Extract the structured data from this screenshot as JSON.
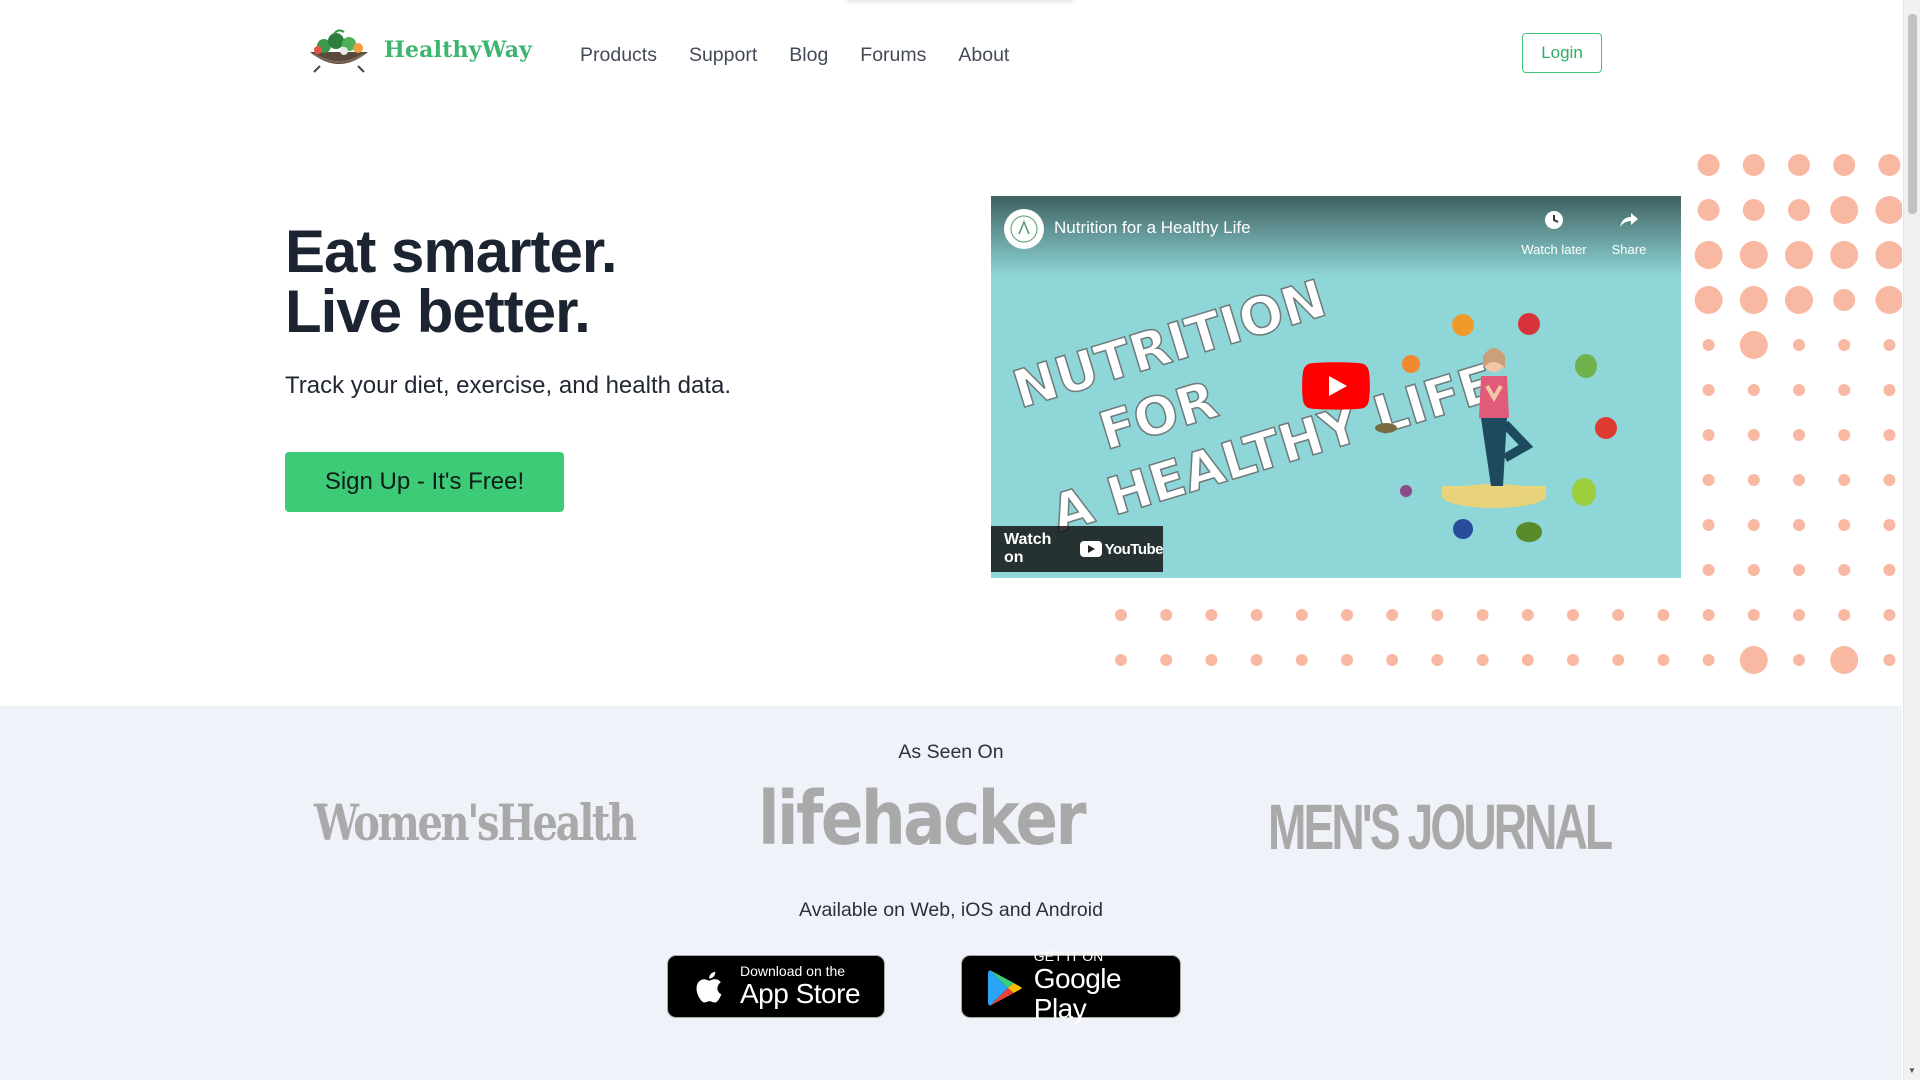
{
  "brand": {
    "logo_text": "HealthyWay",
    "accent_color": "#3ecb78"
  },
  "nav": {
    "items": [
      "Products",
      "Support",
      "Blog",
      "Forums",
      "About"
    ],
    "login_label": "Login"
  },
  "hero": {
    "title_line1": "Eat smarter.",
    "title_line2": "Live better.",
    "subtitle": "Track your diet, exercise, and health data.",
    "cta_label": "Sign Up - It's Free!"
  },
  "video": {
    "title": "Nutrition for a Healthy Life",
    "watch_later_label": "Watch later",
    "share_label": "Share",
    "thumbnail_text": [
      "NUTRITION",
      "FOR",
      "A HEALTHY LIFE"
    ],
    "watch_on_label": "Watch on",
    "youtube_label": "YouTube",
    "background_color": "#8ed6d7"
  },
  "press": {
    "heading": "As Seen On",
    "logos": [
      "Women'sHealth",
      "lifehacker",
      "MEN'S JOURNAL"
    ]
  },
  "apps": {
    "heading": "Available on Web, iOS and Android",
    "app_store_small": "Download on the",
    "app_store_big": "App Store",
    "google_play_small": "GET IT ON",
    "google_play_big": "Google Play"
  },
  "decor": {
    "dot_color": "#f9b8a2"
  }
}
